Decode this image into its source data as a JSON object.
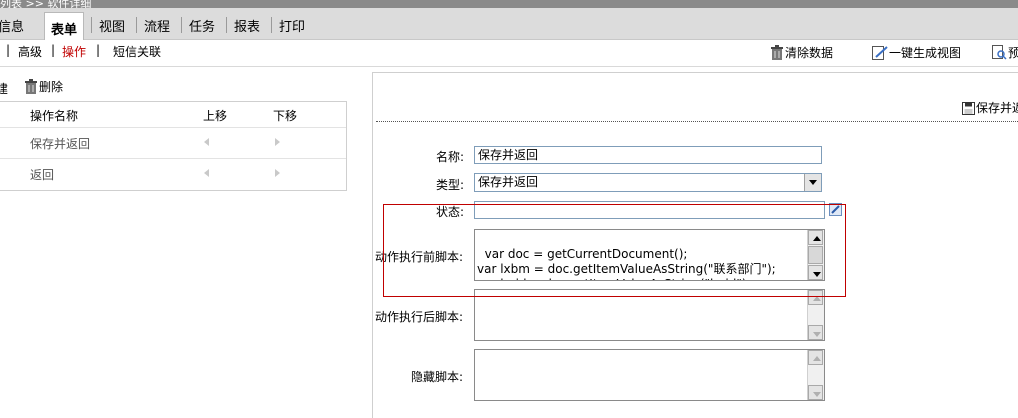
{
  "breadcrumb": {
    "text": "列表 >> 软件详细"
  },
  "main_tabs": [
    "信息",
    "表单",
    "视图",
    "流程",
    "任务",
    "报表",
    "打印"
  ],
  "sub_tabs": [
    "高级",
    "操作",
    "短信关联"
  ],
  "toolbar": {
    "clear_label": "清除数据",
    "gen_view_label": "一键生成视图",
    "preview_label": "预"
  },
  "left_tools": {
    "new_label": "建",
    "delete_label": "删除"
  },
  "op_table": {
    "headers": [
      "操作名称",
      "上移",
      "下移"
    ],
    "rows": [
      "保存并返回",
      "返回"
    ]
  },
  "form": {
    "save_return_label": "保存并返",
    "name_label": "名称:",
    "name_value": "保存并返回",
    "type_label": "类型:",
    "type_value": "保存并返回",
    "status_label": "状态:",
    "status_value": "",
    "pre_script_label": "动作执行前脚本:",
    "pre_script_value": "var doc = getCurrentDocument();\nvar lxbm = doc.getItemValueAsString(\"联系部门\");\nvar lxrid = doc.getItemValueAsString(\"lxrid\");",
    "post_script_label": "动作执行后脚本:",
    "post_script_value": "",
    "hidden_script_label": "隐藏脚本:",
    "hidden_script_value": ""
  },
  "colors": {
    "highlight": "#c00000",
    "active_subtab": "#c00000"
  }
}
